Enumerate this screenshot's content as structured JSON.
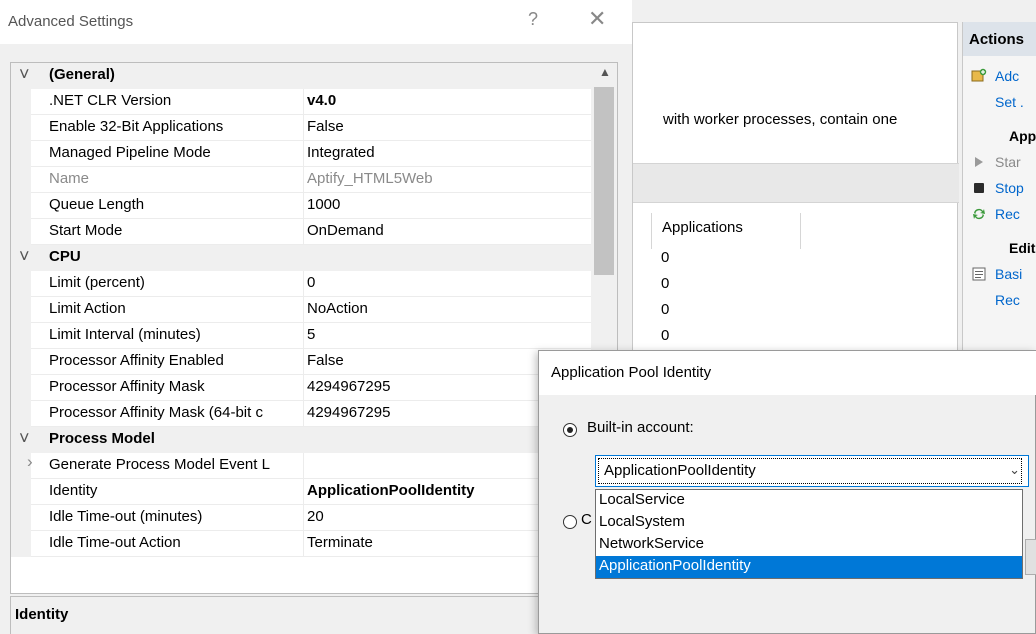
{
  "background": {
    "description_fragment": "with worker processes, contain one",
    "column_applications": "Applications",
    "cells": [
      "0",
      "0",
      "0",
      "0"
    ],
    "actions": {
      "header": "Actions",
      "items": [
        {
          "label": "Adc",
          "kind": "link",
          "icon": "add-pool-icon"
        },
        {
          "label": "Set .",
          "kind": "link",
          "icon": ""
        },
        {
          "label": "App",
          "kind": "heading",
          "icon": ""
        },
        {
          "label": "Star",
          "kind": "disabled",
          "icon": "start-icon"
        },
        {
          "label": "Stop",
          "kind": "link",
          "icon": "stop-icon"
        },
        {
          "label": "Rec",
          "kind": "link",
          "icon": "recycle-icon"
        },
        {
          "label": "Edit",
          "kind": "heading",
          "icon": ""
        },
        {
          "label": "Basi",
          "kind": "link",
          "icon": "basic-settings-icon"
        },
        {
          "label": "Rec",
          "kind": "link",
          "icon": ""
        }
      ]
    }
  },
  "advanced_settings": {
    "title": "Advanced Settings",
    "help_glyph": "?",
    "close_glyph": "✕",
    "rows": [
      {
        "type": "category",
        "name": "(General)",
        "expanded": true
      },
      {
        "type": "prop",
        "name": ".NET CLR Version",
        "value": "v4.0",
        "value_bold": true
      },
      {
        "type": "prop",
        "name": "Enable 32-Bit Applications",
        "value": "False"
      },
      {
        "type": "prop",
        "name": "Managed Pipeline Mode",
        "value": "Integrated"
      },
      {
        "type": "prop",
        "name": "Name",
        "value": "Aptify_HTML5Web",
        "disabled": true
      },
      {
        "type": "prop",
        "name": "Queue Length",
        "value": "1000"
      },
      {
        "type": "prop",
        "name": "Start Mode",
        "value": "OnDemand"
      },
      {
        "type": "category",
        "name": "CPU",
        "expanded": true
      },
      {
        "type": "prop",
        "name": "Limit (percent)",
        "value": "0"
      },
      {
        "type": "prop",
        "name": "Limit Action",
        "value": "NoAction"
      },
      {
        "type": "prop",
        "name": "Limit Interval (minutes)",
        "value": "5"
      },
      {
        "type": "prop",
        "name": "Processor Affinity Enabled",
        "value": "False"
      },
      {
        "type": "prop",
        "name": "Processor Affinity Mask",
        "value": "4294967295"
      },
      {
        "type": "prop",
        "name": "Processor Affinity Mask (64-bit c",
        "value": "4294967295"
      },
      {
        "type": "category",
        "name": "Process Model",
        "expanded": true
      },
      {
        "type": "subgroup",
        "name": "Generate Process Model Event L",
        "value": ""
      },
      {
        "type": "prop",
        "name": "Identity",
        "value": "ApplicationPoolIdentity",
        "value_bold": true
      },
      {
        "type": "prop",
        "name": "Idle Time-out (minutes)",
        "value": "20"
      },
      {
        "type": "prop",
        "name": "Idle Time-out Action",
        "value": "Terminate"
      }
    ],
    "description_title": "Identity"
  },
  "app_pool_identity": {
    "title": "Application Pool Identity",
    "builtin_label": "Built-in account:",
    "builtin_selected": true,
    "custom_label_fragment": "C",
    "selected_value": "ApplicationPoolIdentity",
    "options": [
      "LocalService",
      "LocalSystem",
      "NetworkService",
      "ApplicationPoolIdentity"
    ],
    "highlighted_option": "ApplicationPoolIdentity"
  },
  "colors": {
    "accent": "#0078d7",
    "link": "#0066cc",
    "category_bg": "#f0f0f0"
  }
}
